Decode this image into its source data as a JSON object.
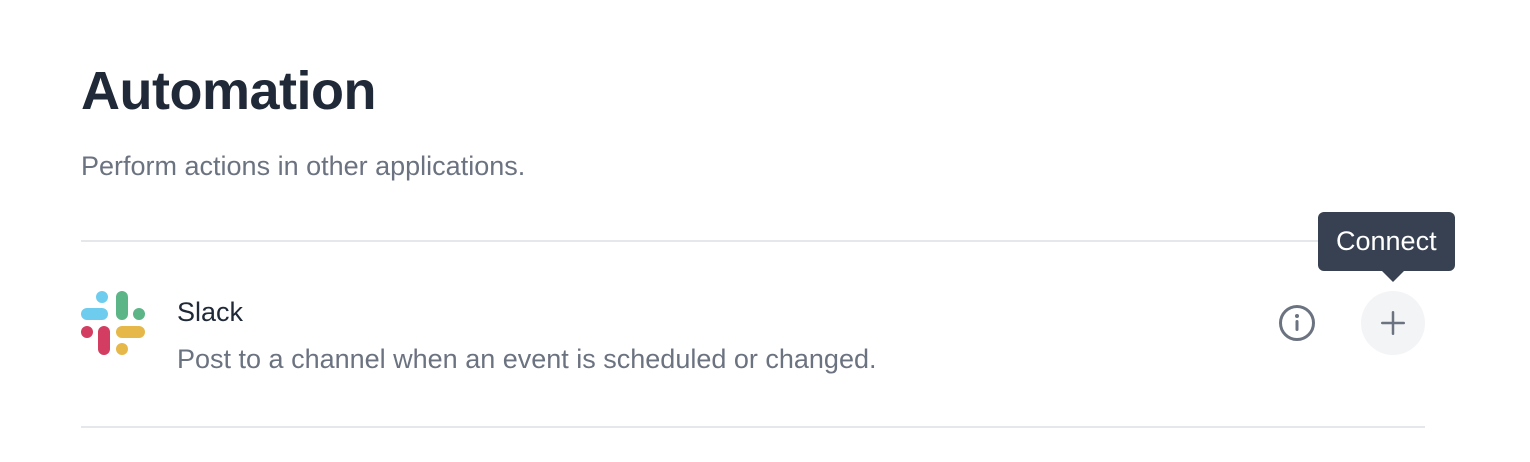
{
  "page": {
    "title": "Automation",
    "subtitle": "Perform actions in other applications."
  },
  "apps": [
    {
      "name": "Slack",
      "description": "Post to a channel when an event is scheduled or changed.",
      "logo_icon": "slack-logo",
      "info_icon": "info-circle-icon",
      "connect_icon": "plus-icon"
    }
  ],
  "tooltip": {
    "label": "Connect"
  },
  "colors": {
    "heading": "#1f2937",
    "muted_text": "#6b7280",
    "divider": "#e5e7eb",
    "tooltip_bg": "#374151",
    "button_bg": "#f3f4f6",
    "slack_blue": "#36C5F0",
    "slack_green": "#2EB67D",
    "slack_yellow": "#ECB22E",
    "slack_red": "#E01E5A"
  }
}
